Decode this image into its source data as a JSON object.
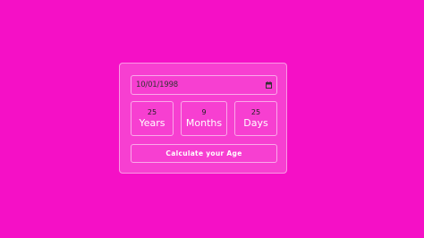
{
  "colors": {
    "background": "#f510c6",
    "card": "rgba(255,255,255,0.2)",
    "border": "rgba(255,255,255,0.55)",
    "text_light": "#ffffff",
    "text_dark": "#222222"
  },
  "date_input": {
    "value": "10/01/1998",
    "icon": "calendar-icon"
  },
  "results": {
    "years": {
      "value": "25",
      "unit": "Years"
    },
    "months": {
      "value": "9",
      "unit": "Months"
    },
    "days": {
      "value": "25",
      "unit": "Days"
    }
  },
  "button": {
    "label": "Calculate your Age"
  }
}
